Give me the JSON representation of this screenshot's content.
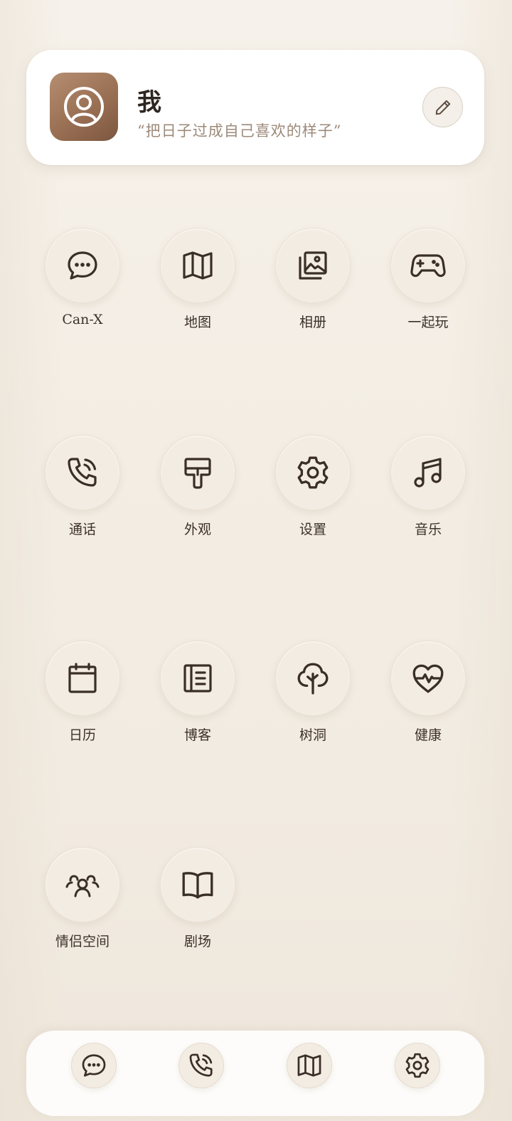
{
  "profile": {
    "name": "我",
    "motto": "“把日子过成自己喜欢的样子”",
    "avatar_icon": "user-circle-icon",
    "edit_icon": "pencil-icon"
  },
  "apps": [
    {
      "label": "Can-X",
      "icon": "chat-bubble-icon"
    },
    {
      "label": "地图",
      "icon": "map-icon"
    },
    {
      "label": "相册",
      "icon": "photo-album-icon"
    },
    {
      "label": "一起玩",
      "icon": "gamepad-icon"
    },
    {
      "label": "通话",
      "icon": "phone-call-icon"
    },
    {
      "label": "外观",
      "icon": "paint-roller-icon"
    },
    {
      "label": "设置",
      "icon": "gear-icon"
    },
    {
      "label": "音乐",
      "icon": "music-note-icon"
    },
    {
      "label": "日历",
      "icon": "calendar-icon"
    },
    {
      "label": "博客",
      "icon": "notebook-icon"
    },
    {
      "label": "树洞",
      "icon": "tree-icon"
    },
    {
      "label": "健康",
      "icon": "heart-pulse-icon"
    },
    {
      "label": "情侣空间",
      "icon": "people-icon"
    },
    {
      "label": "剧场",
      "icon": "open-book-icon"
    }
  ],
  "dock": [
    {
      "icon": "chat-bubble-icon"
    },
    {
      "icon": "phone-call-icon"
    },
    {
      "icon": "map-icon"
    },
    {
      "icon": "gear-icon"
    }
  ],
  "colors": {
    "background": "#f3ede4",
    "card": "#ffffff",
    "icon_stroke": "#3a2f28",
    "avatar": "#9a7054",
    "motto_text": "#9c8a7a"
  }
}
